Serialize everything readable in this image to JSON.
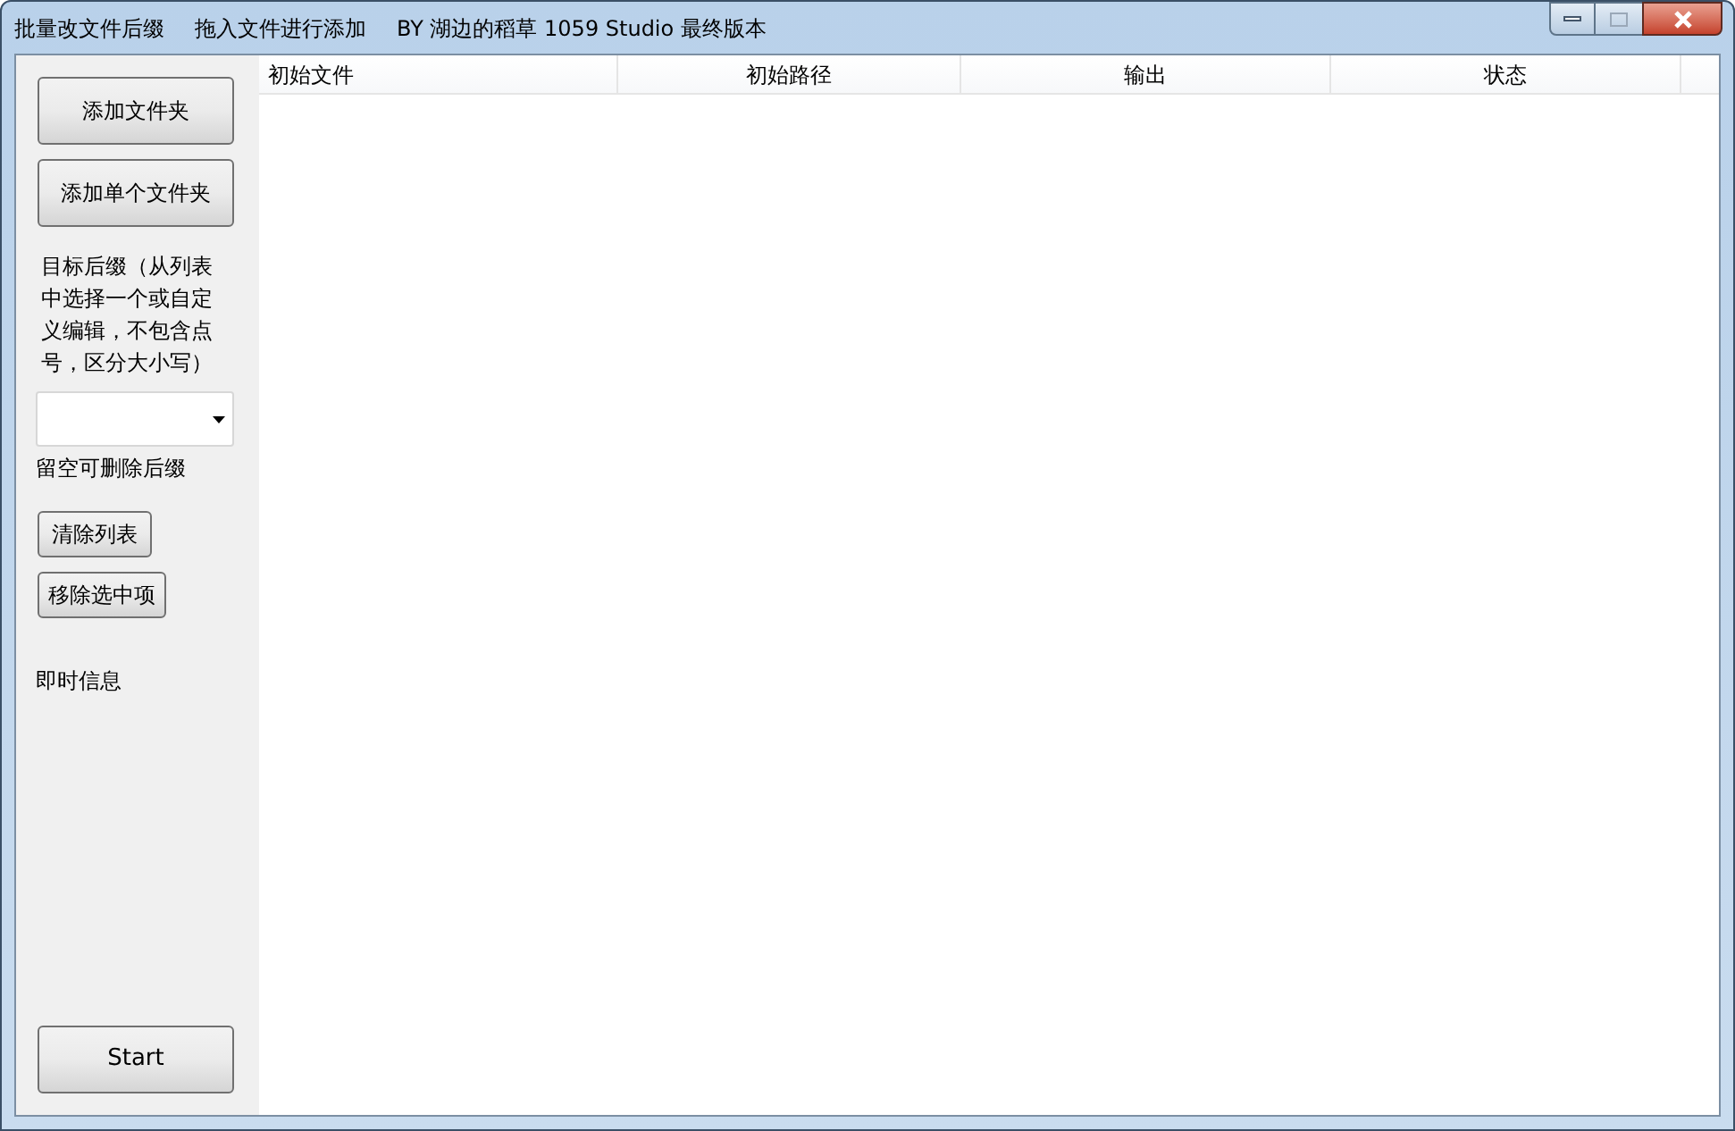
{
  "window": {
    "title_parts": [
      "批量改文件后缀",
      "拖入文件进行添加",
      "BY 湖边的稻草 1059 Studio 最终版本"
    ]
  },
  "sidebar": {
    "add_folder_button": "添加文件夹",
    "add_single_folder_button": "添加单个文件夹",
    "suffix_label": "目标后缀（从列表中选择一个或自定义编辑，不包含点号，区分大小写）",
    "suffix_hint": "留空可删除后缀",
    "clear_button": "清除列表",
    "remove_button": "移除选中项",
    "info_label": "即时信息",
    "start_button": "Start"
  },
  "table": {
    "columns": [
      {
        "label": "初始文件"
      },
      {
        "label": "初始路径"
      },
      {
        "label": "输出"
      },
      {
        "label": "状态"
      }
    ]
  }
}
